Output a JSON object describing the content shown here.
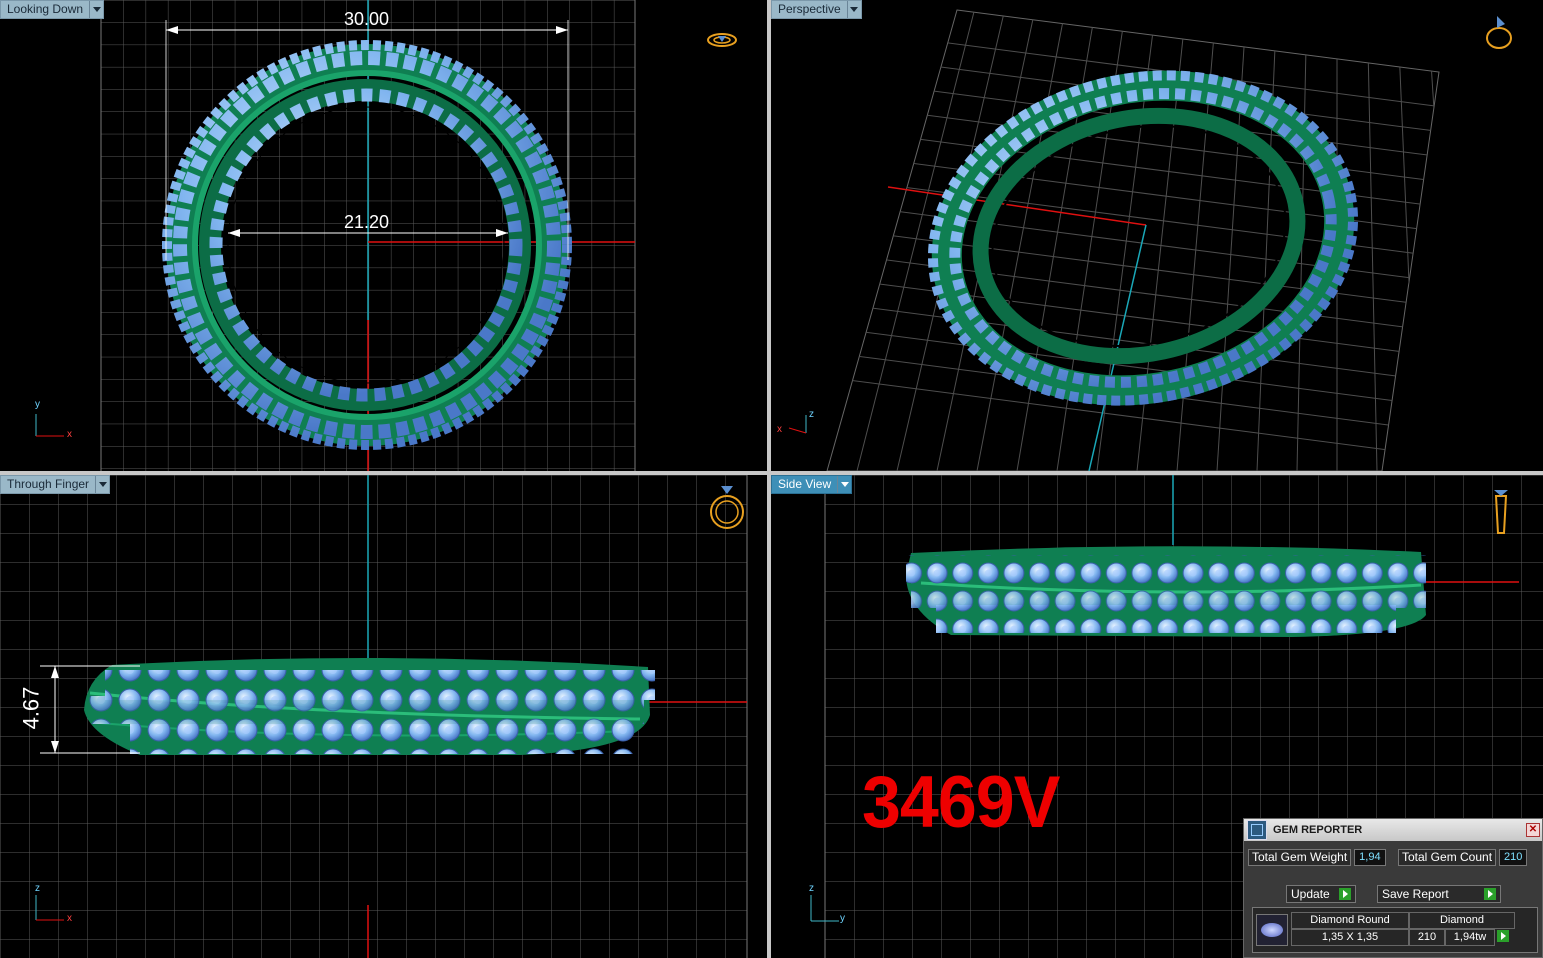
{
  "viewports": {
    "top_left": {
      "label": "Looking Down",
      "active": false,
      "dimensions": [
        "30.00",
        "21.20"
      ],
      "axes": [
        "y",
        "x"
      ]
    },
    "top_right": {
      "label": "Perspective",
      "active": false,
      "axes": [
        "z",
        "x"
      ]
    },
    "bottom_left": {
      "label": "Through Finger",
      "active": false,
      "dimensions": [
        "4.67"
      ],
      "axes": [
        "z",
        "x"
      ]
    },
    "bottom_right": {
      "label": "Side View",
      "active": true,
      "axes": [
        "z",
        "y"
      ]
    }
  },
  "model_code": "3469V",
  "colors": {
    "model_code": "#ee0000",
    "metal": "#0f8a5a",
    "gem": "#7fb4ee",
    "grid": "#555555",
    "axis_x": "#e01010",
    "axis_y": "#1aa8b8",
    "active_tab": "#3e8fb7"
  },
  "gem_reporter": {
    "title": "GEM REPORTER",
    "total_weight_label": "Total Gem Weight",
    "total_weight": "1,94",
    "total_count_label": "Total Gem Count",
    "total_count": "210",
    "update_label": "Update",
    "save_label": "Save Report",
    "row": {
      "name": "Diamond Round",
      "size": "1,35 X 1,35",
      "type": "Diamond",
      "count": "210",
      "weight": "1,94tw"
    }
  }
}
